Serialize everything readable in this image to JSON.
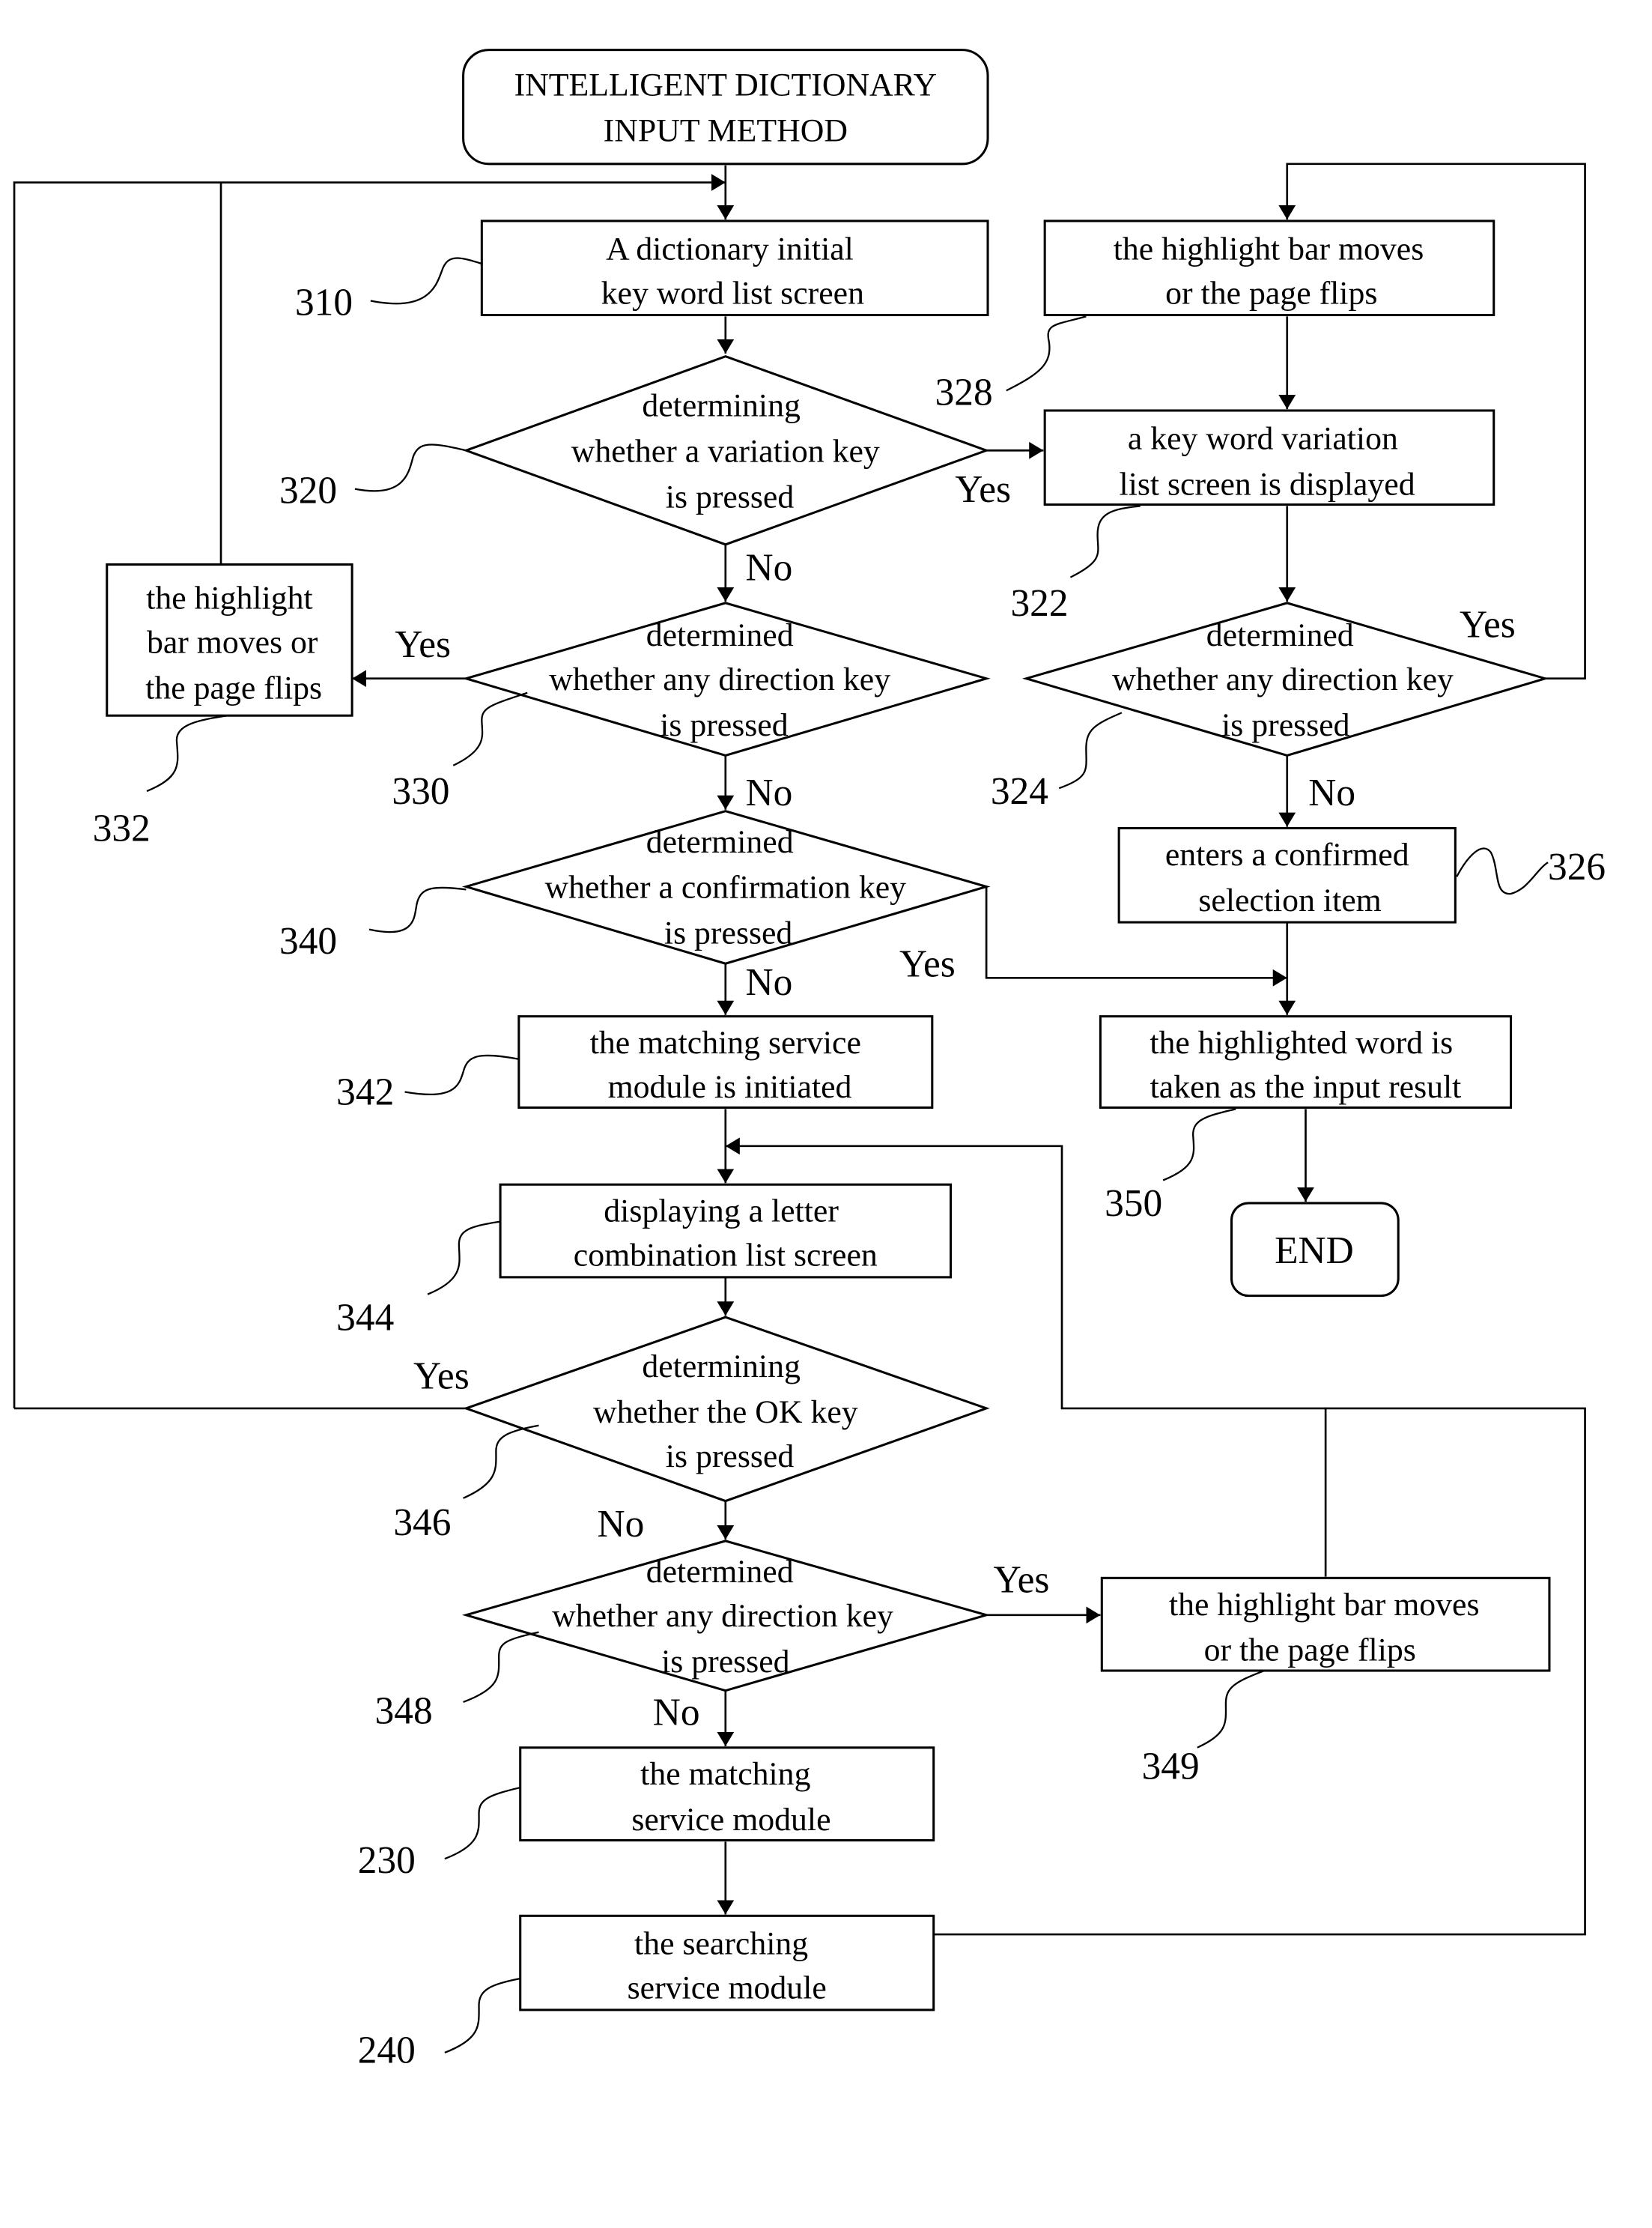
{
  "diagram": {
    "type": "flowchart",
    "colors": {
      "line": "#000000",
      "background": "#ffffff"
    },
    "nodes": {
      "start": {
        "kind": "terminator",
        "lines": [
          "INTELLIGENT DICTIONARY",
          "INPUT METHOD"
        ]
      },
      "n310": {
        "kind": "process",
        "ref": "310",
        "lines": [
          "A dictionary initial",
          "key word list screen"
        ]
      },
      "n320": {
        "kind": "decision",
        "ref": "320",
        "lines": [
          "determining",
          "whether a variation key",
          "is pressed"
        ]
      },
      "n328": {
        "kind": "process",
        "ref": "328",
        "lines": [
          "the highlight bar moves",
          "or the page flips"
        ]
      },
      "n322": {
        "kind": "process",
        "ref": "322",
        "lines": [
          "a key word variation",
          "list screen is displayed"
        ]
      },
      "n332": {
        "kind": "process",
        "ref": "332",
        "lines": [
          "the highlight",
          "bar moves or",
          "the page flips"
        ]
      },
      "n330": {
        "kind": "decision",
        "ref": "330",
        "lines": [
          "determined",
          "whether any direction key",
          "is pressed"
        ]
      },
      "n324": {
        "kind": "decision",
        "ref": "324",
        "lines": [
          "determined",
          "whether any direction key",
          "is pressed"
        ]
      },
      "n340": {
        "kind": "decision",
        "ref": "340",
        "lines": [
          "determined",
          "whether a confirmation key",
          "is pressed"
        ]
      },
      "n326": {
        "kind": "process",
        "ref": "326",
        "lines": [
          "enters a confirmed",
          "selection item"
        ]
      },
      "n342": {
        "kind": "process",
        "ref": "342",
        "lines": [
          "the matching service",
          "module is initiated"
        ]
      },
      "n350": {
        "kind": "process",
        "ref": "350",
        "lines": [
          "the highlighted word is",
          "taken as the input result"
        ]
      },
      "end": {
        "kind": "terminator",
        "lines": [
          "END"
        ]
      },
      "n344": {
        "kind": "process",
        "ref": "344",
        "lines": [
          "displaying a letter",
          "combination list screen"
        ]
      },
      "n346": {
        "kind": "decision",
        "ref": "346",
        "lines": [
          "determining",
          "whether the OK key",
          "is pressed"
        ]
      },
      "n348": {
        "kind": "decision",
        "ref": "348",
        "lines": [
          "determined",
          "whether any direction key",
          "is pressed"
        ]
      },
      "n349": {
        "kind": "process",
        "ref": "349",
        "lines": [
          "the highlight bar moves",
          "or the page flips"
        ]
      },
      "n230": {
        "kind": "process",
        "ref": "230",
        "lines": [
          "the matching",
          "service module"
        ]
      },
      "n240": {
        "kind": "process",
        "ref": "240",
        "lines": [
          "the searching",
          "service module"
        ]
      }
    },
    "branch_labels": {
      "yes": "Yes",
      "no": "No"
    }
  }
}
